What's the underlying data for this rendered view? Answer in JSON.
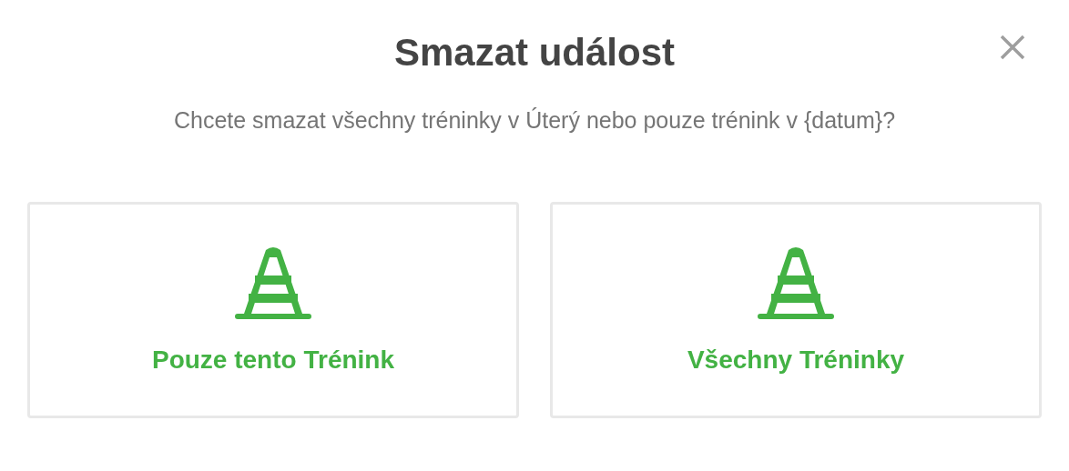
{
  "dialog": {
    "title": "Smazat událost",
    "message": "Chcete smazat všechny tréninky v Úterý nebo pouze trénink v {datum}?"
  },
  "options": [
    {
      "label": "Pouze tento Trénink"
    },
    {
      "label": "Všechny Tréninky"
    }
  ]
}
